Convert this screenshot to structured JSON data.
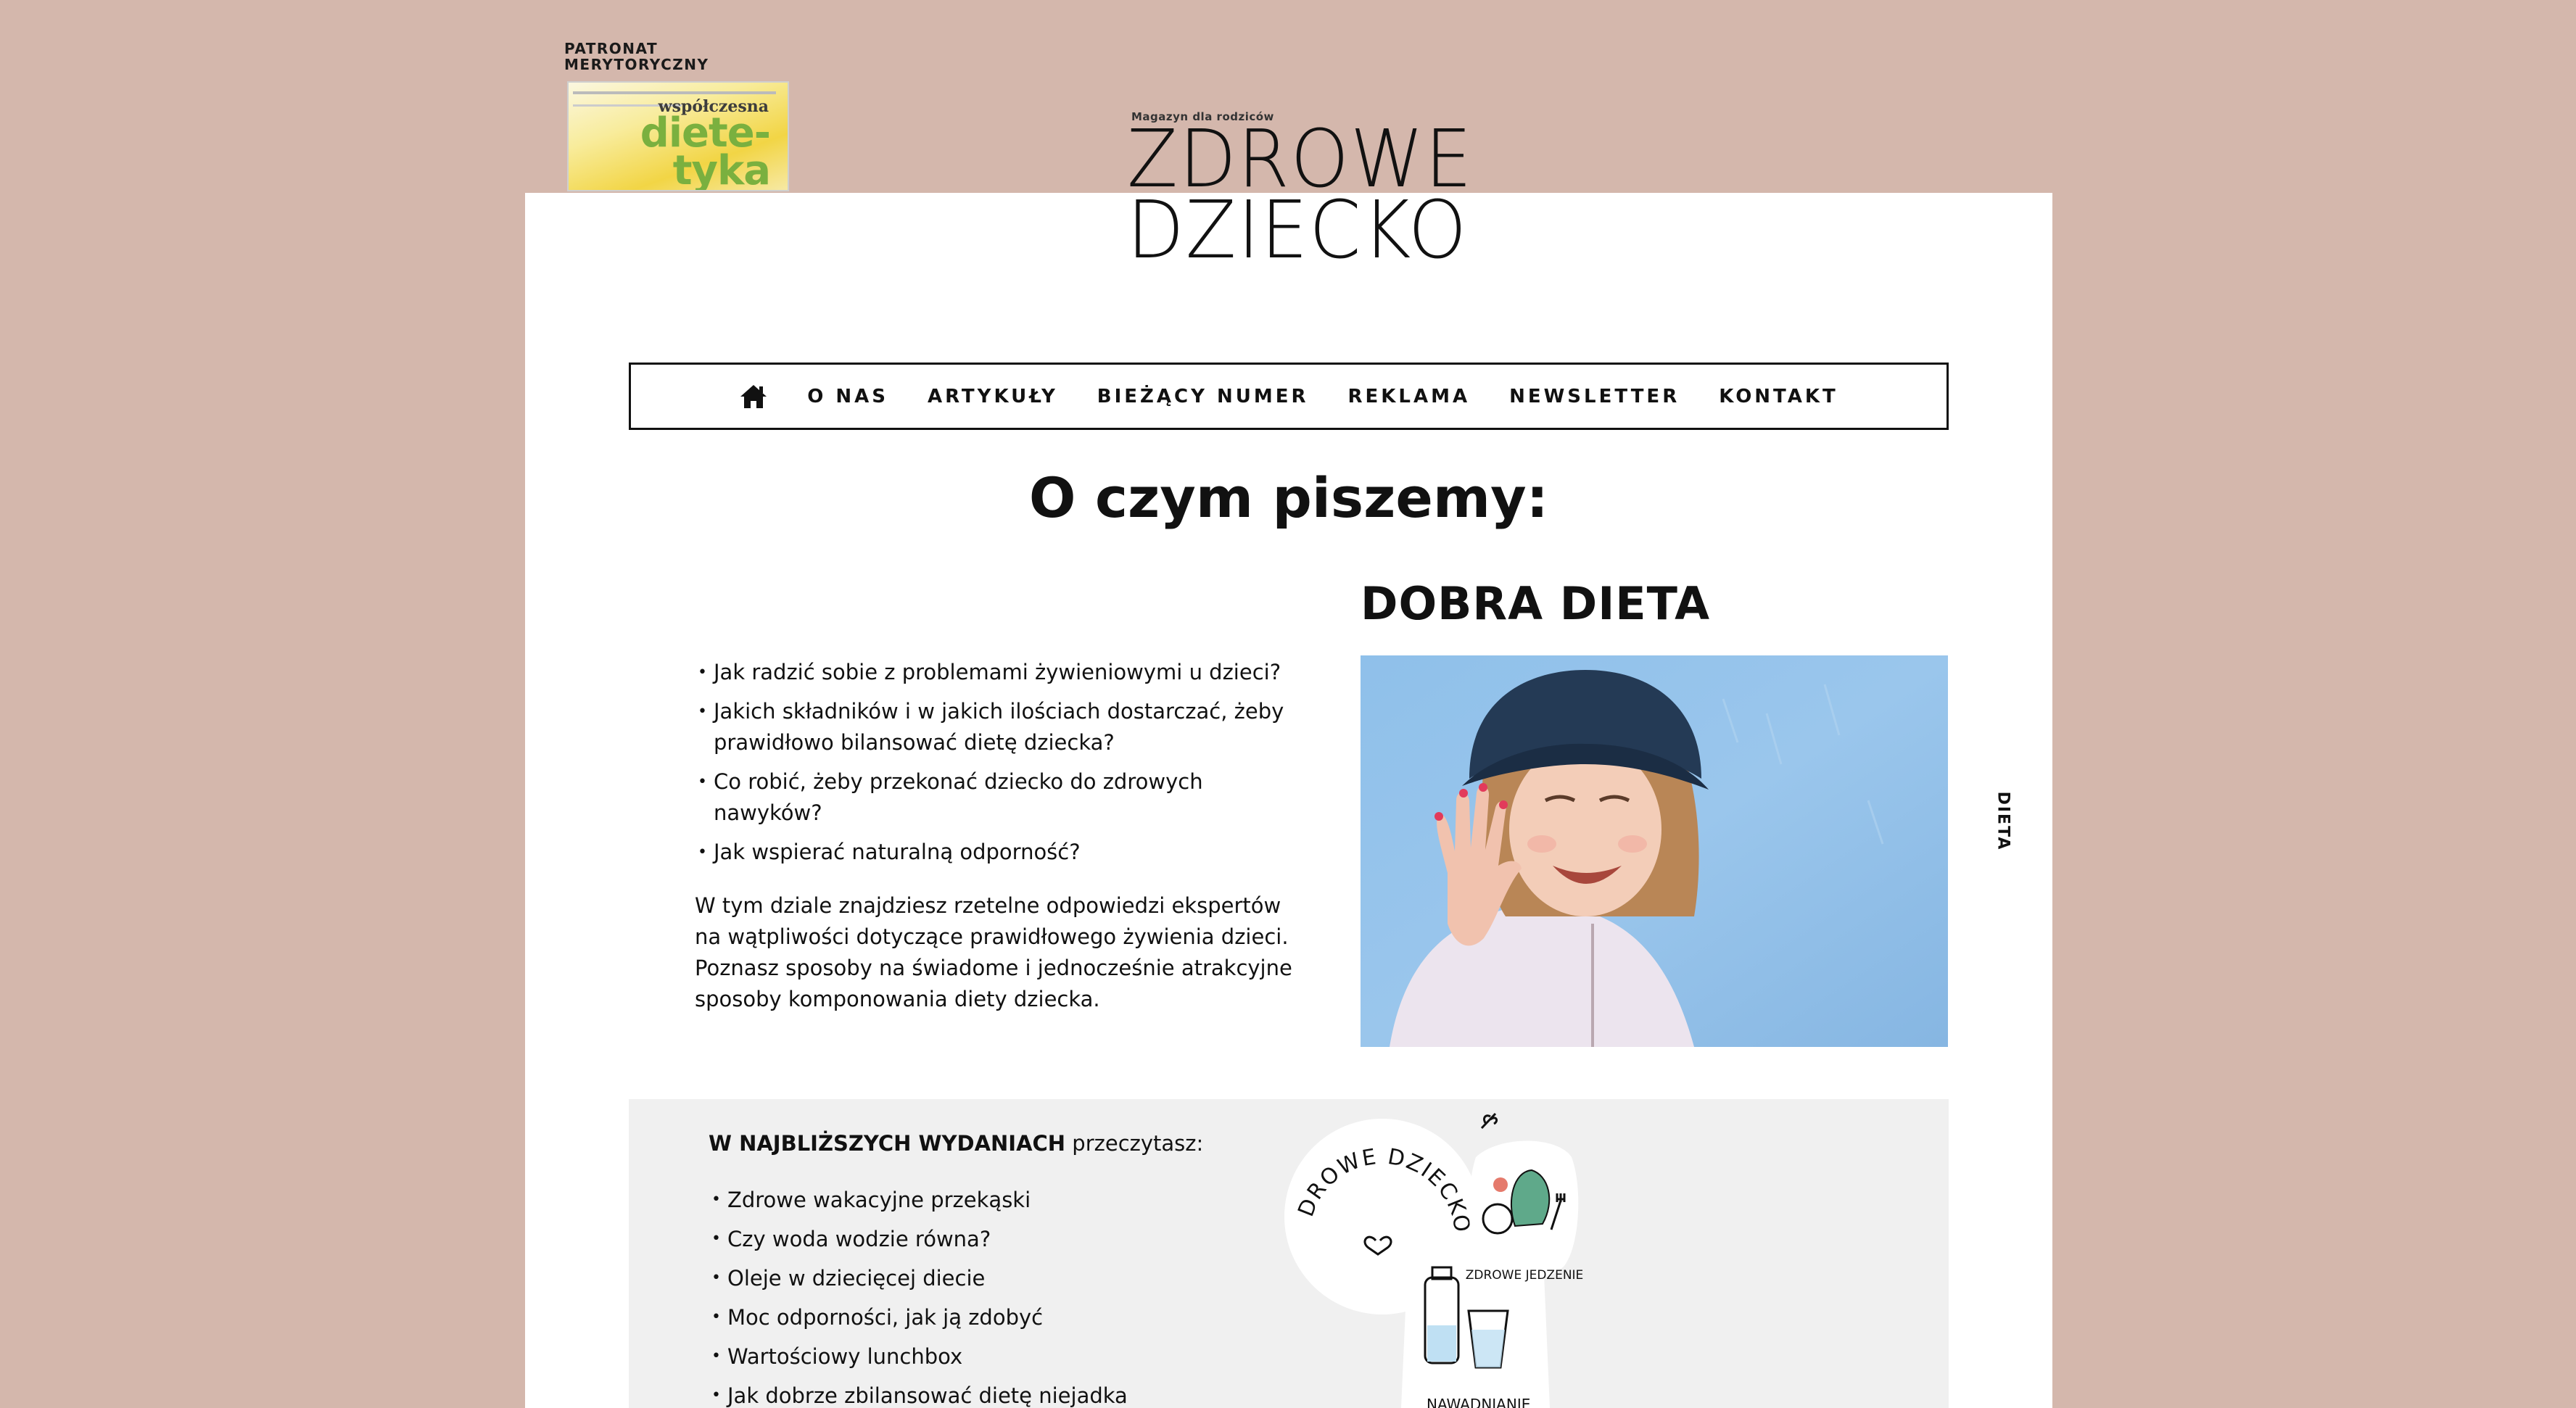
{
  "patronat": {
    "label_line1": "PATRONAT",
    "label_line2": "MERYTORYCZNY",
    "cover_subtitle": "współczesna",
    "cover_title_line1": "diete-",
    "cover_title_line2": "tyka"
  },
  "logo": {
    "tagline": "Magazyn dla rodziców",
    "line1": "ZDROWE",
    "line2": "DZIECKO"
  },
  "nav": {
    "home_icon": "home-icon",
    "items": [
      "O NAS",
      "ARTYKUŁY",
      "BIEŻĄCY NUMER",
      "REKLAMA",
      "NEWSLETTER",
      "KONTAKT"
    ]
  },
  "main": {
    "heading": "O czym piszemy:",
    "section_title": "DOBRA DIETA",
    "questions": [
      "Jak radzić sobie z problemami żywieniowymi u dzieci?",
      "Jakich składników i w jakich ilościach dostarczać, żeby prawidłowo bilansować dietę dziecka?",
      "Co robić, żeby przekonać dziecko do zdrowych nawyków?",
      "Jak wspierać naturalną odporność?"
    ],
    "description": "W tym dziale znajdziesz rzetelne odpowiedzi ekspertów na wątpliwości dotyczące prawidłowego żywienia dzieci. Poznasz sposoby na świadome i jednocześnie atrakcyjne sposoby komponowania diety dziecka.",
    "side_label": "DIETA"
  },
  "upcoming": {
    "title_bold": "W NAJBLIŻSZYCH WYDANIACH",
    "title_rest": " przeczytasz:",
    "items": [
      "Zdrowe wakacyjne przekąski",
      "Czy woda wodzie równa?",
      "Oleje w dziecięcej diecie",
      "Moc odporności, jak ją zdobyć",
      "Wartościowy lunchbox",
      "Jak dobrze zbilansować dietę niejadka"
    ],
    "badges": {
      "circle_text": "ZDROWE DZIECKO",
      "food_label": "ZDROWE JEDZENIE",
      "water_label": "NAWADNIANIE"
    }
  },
  "colors": {
    "page_background": "#d4b7ac",
    "card_background": "#ffffff",
    "panel_background": "#f0f0f0",
    "text": "#111111",
    "cover_accent": "#7ab03f"
  }
}
